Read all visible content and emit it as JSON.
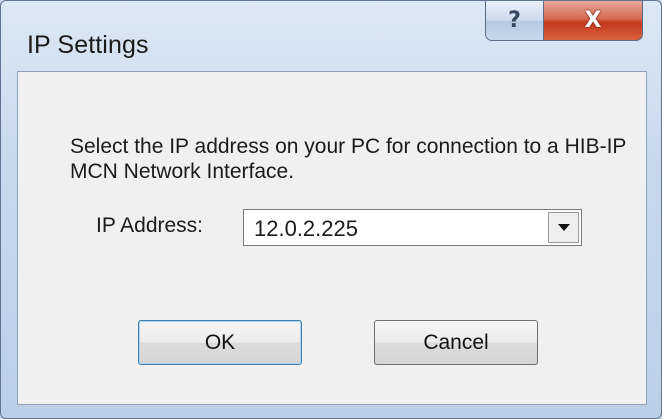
{
  "window": {
    "title": "IP Settings",
    "help_glyph": "?",
    "close_glyph": "X"
  },
  "dialog": {
    "prompt": "Select the IP address on your PC for  connection to a HIB-IP MCN Network Interface.",
    "ip_label": "IP Address:",
    "ip_value": "12.0.2.225",
    "ok_label": "OK",
    "cancel_label": "Cancel"
  },
  "colors": {
    "close_button": "#c43a1e",
    "client_background": "#f0f0f0",
    "frame": "#c7d8ec"
  }
}
